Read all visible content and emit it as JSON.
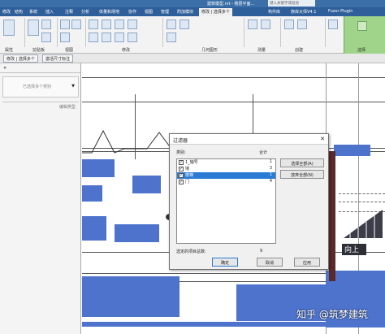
{
  "titlebar": {
    "title": "建筑模型.rvt - 楼层平面...",
    "search_placeholder": "键入关键字或短语"
  },
  "tabs": [
    "修改",
    "结构",
    "系统",
    "插入",
    "注释",
    "分析",
    "体量和场地",
    "协作",
    "视图",
    "管理",
    "附加模块",
    "修改 | 选择多个"
  ],
  "right_tabs": [
    "构件库",
    "族库大师V4.1",
    "Fuzor Plugin"
  ],
  "ribbon_groups": [
    "属性",
    "剪贴板",
    "几何图形",
    "修改",
    "视图",
    "测量",
    "创建",
    "选择"
  ],
  "ctx_buttons": [
    "修改 | 选择多个",
    "激活尺寸标注"
  ],
  "props": {
    "item": "已选择多个类别",
    "edit_type": "编辑类型"
  },
  "dialog": {
    "title": "过滤器",
    "col_category": "类别:",
    "col_total": "合计",
    "rows": [
      {
        "name": "1_轴号",
        "count": "1",
        "checked": "true",
        "selected": "false"
      },
      {
        "name": "墙",
        "count": "3",
        "checked": "true",
        "selected": "false"
      },
      {
        "name": "楼梯",
        "count": "1",
        "checked": "true",
        "selected": "true"
      },
      {
        "name": "门",
        "count": "4",
        "checked": "true",
        "selected": "false"
      }
    ],
    "check_all": "选择全部(A)",
    "check_none": "放弃全部(N)",
    "total_label": "选定的项目总数:",
    "total_value": "9",
    "ok": "确定",
    "cancel": "取消",
    "apply": "应用"
  },
  "canvas_label": "向上",
  "watermark": "知乎 @筑梦建筑"
}
